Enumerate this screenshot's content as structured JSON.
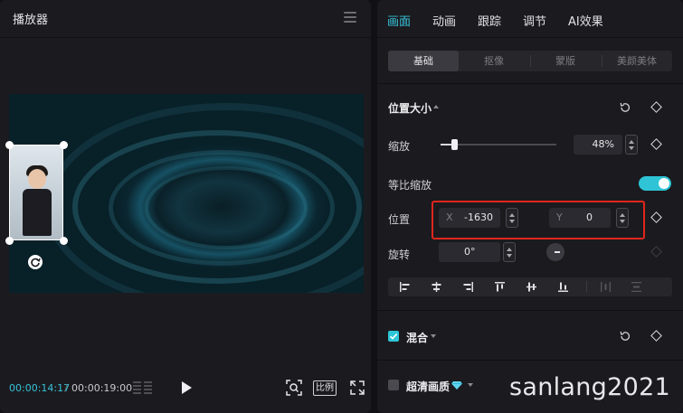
{
  "player": {
    "title": "播放器",
    "time_current": "00:00:14:17",
    "time_separator": "/",
    "time_total": "00:00:19:00",
    "ratio_label": "比例"
  },
  "inspector": {
    "tabs": [
      "画面",
      "动画",
      "跟踪",
      "调节",
      "AI效果"
    ],
    "active_tab": "画面",
    "subtabs": [
      "基础",
      "抠像",
      "蒙版",
      "美颜美体"
    ],
    "active_subtab": "基础",
    "position_size": {
      "title": "位置大小",
      "scale_label": "缩放",
      "scale_value": "48%",
      "scale_slider_fraction": 0.12,
      "uniform_scale_label": "等比缩放",
      "uniform_scale_on": true,
      "position_label": "位置",
      "x_tag": "X",
      "x_value": "-1630",
      "y_tag": "Y",
      "y_value": "0",
      "rotation_label": "旋转",
      "rotation_value": "0°"
    },
    "blend": {
      "label": "混合",
      "checked": true
    },
    "hd_quality": {
      "label": "超清画质",
      "checked": false
    }
  },
  "accent_color": "#2ec4d6",
  "highlight_color": "#e0261c",
  "watermark": "sanlang2021"
}
